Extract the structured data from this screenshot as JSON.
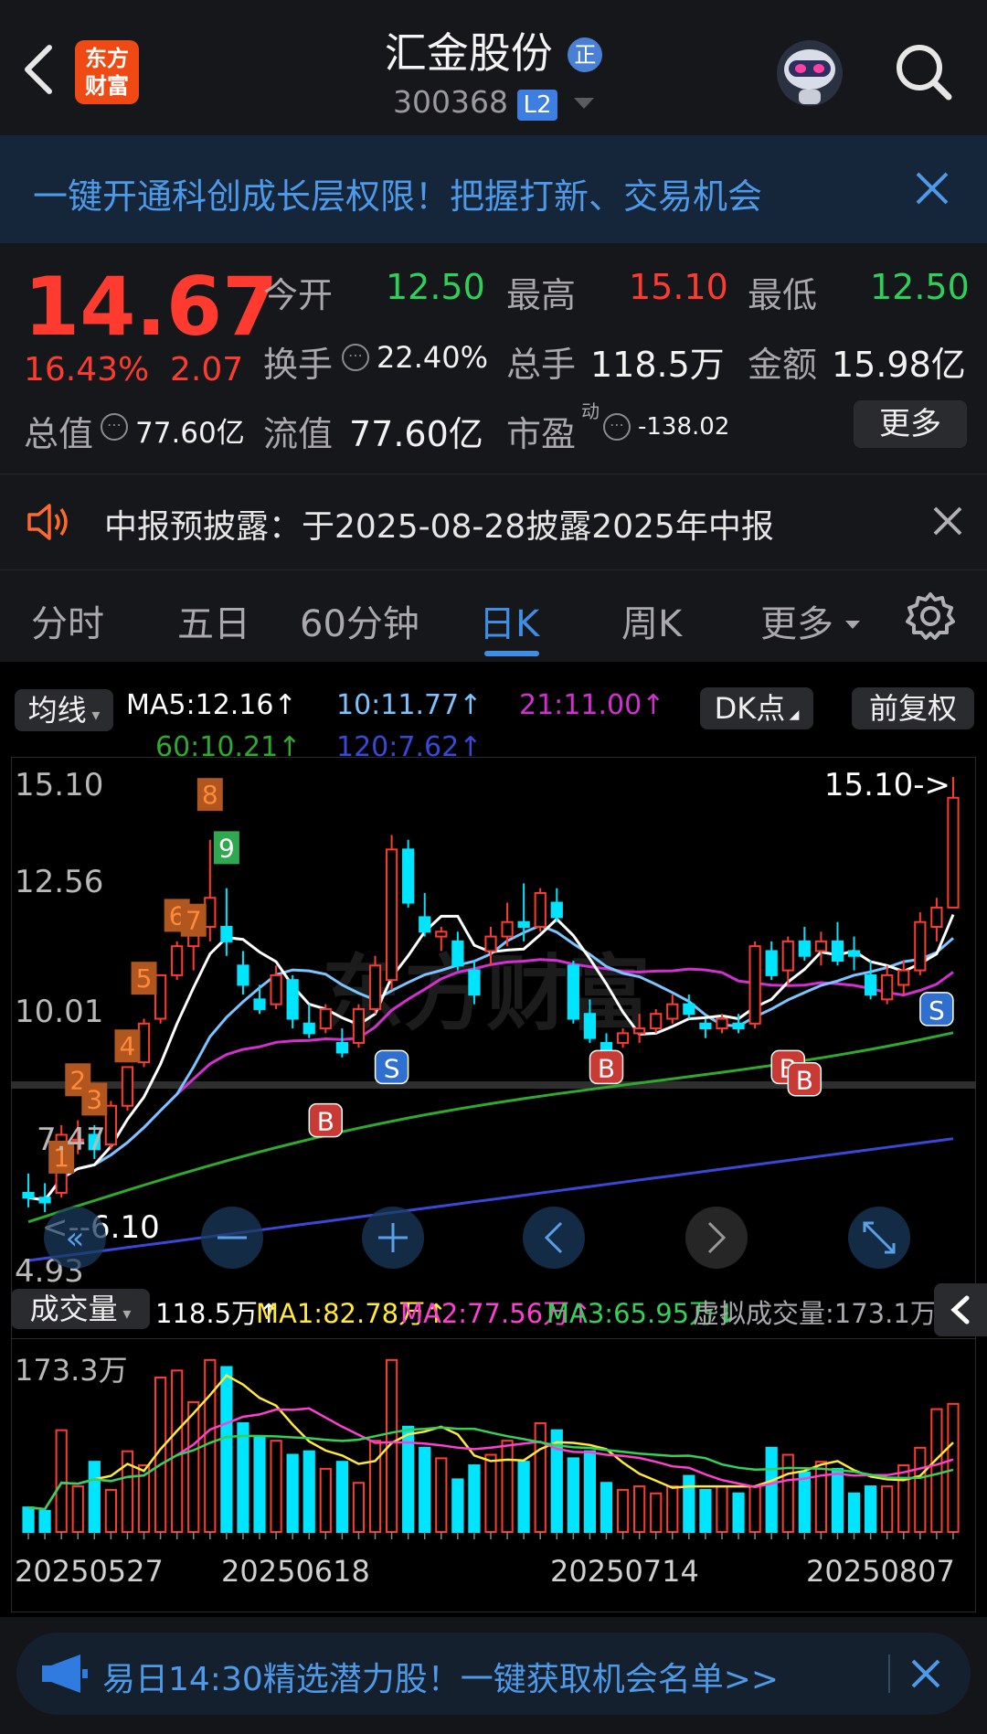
{
  "header": {
    "title": "汇金股份",
    "badge": "正",
    "logo_line1": "东方",
    "logo_line2": "财富",
    "code": "300368",
    "level": "L2"
  },
  "banner": {
    "text": "一键开通科创成长层权限！把握打新、交易机会"
  },
  "quote": {
    "price": "14.67",
    "change_pct": "16.43%",
    "change": "2.07",
    "open_label": "今开",
    "open": "12.50",
    "high_label": "最高",
    "high": "15.10",
    "low_label": "最低",
    "low": "12.50",
    "turnover_label": "换手",
    "turnover": "22.40%",
    "volume_label": "总手",
    "volume": "118.5万",
    "amount_label": "金额",
    "amount": "15.98亿",
    "mktcap_label": "总值",
    "mktcap": "77.60亿",
    "float_label": "流值",
    "float_cap": "77.60亿",
    "pe_label": "市盈",
    "pe_sup": "动",
    "pe": "-138.02",
    "more_label": "更多"
  },
  "notice": {
    "text": "中报预披露：于2025-08-28披露2025年中报"
  },
  "tabs": [
    "分时",
    "五日",
    "60分钟",
    "日K",
    "周K",
    "更多"
  ],
  "active_tab": 3,
  "chart_controls": {
    "ma_select": "均线",
    "ma5": "MA5:12.16↑",
    "ma10": "10:11.77↑",
    "ma21": "21:11.00↑",
    "ma60": "60:10.21↑",
    "ma120": "120:7.62↑",
    "dk_label": "DK点",
    "adjust_label": "前复权"
  },
  "price_axis": {
    "top": "15.10",
    "mid1": "12.56",
    "mid2": "10.01",
    "low1": "7.47",
    "bottom": "4.93"
  },
  "price_annot": {
    "high": "15.10->",
    "low": "<--6.10"
  },
  "volume": {
    "select": "成交量",
    "current": "118.5万↑",
    "ma1": "MA1:82.78万↑",
    "ma2": "MA2:77.56万↑",
    "ma3": "MA3:65.95万↓",
    "virtual": "虚拟成交量:173.1万",
    "axis_top": "173.3万"
  },
  "dates": [
    "20250527",
    "20250618",
    "20250714",
    "20250807"
  ],
  "signals": {
    "b": "B",
    "s": "S",
    "seq": [
      "1",
      "2",
      "3",
      "4",
      "5",
      "6",
      "7",
      "8",
      "9"
    ]
  },
  "watermark": "东方财富",
  "bottom_ad": {
    "text": "易日14:30精选潜力股！一键获取机会名单>>"
  },
  "colors": {
    "up": "#ff3b30",
    "down": "#00e5ff",
    "ma5": "#ffffff",
    "ma10": "#7cc4ff",
    "ma21": "#d42fd0",
    "ma60": "#2faa2f",
    "ma120": "#3a48d8",
    "accent": "#3d8fe6"
  },
  "chart_data": {
    "type": "candlestick",
    "x_labels": [
      "20250527",
      "20250618",
      "20250714",
      "20250807"
    ],
    "ylim": [
      4.93,
      15.1
    ],
    "candles": [
      {
        "o": 6.5,
        "h": 6.9,
        "l": 6.2,
        "c": 6.4
      },
      {
        "o": 6.4,
        "h": 6.7,
        "l": 6.1,
        "c": 6.3
      },
      {
        "o": 6.5,
        "h": 7.9,
        "l": 6.4,
        "c": 7.7
      },
      {
        "o": 7.6,
        "h": 8.0,
        "l": 7.3,
        "c": 7.6
      },
      {
        "o": 7.7,
        "h": 7.9,
        "l": 7.2,
        "c": 7.4
      },
      {
        "o": 7.5,
        "h": 8.4,
        "l": 7.4,
        "c": 8.3
      },
      {
        "o": 8.3,
        "h": 9.1,
        "l": 8.2,
        "c": 9.1
      },
      {
        "o": 9.2,
        "h": 10.1,
        "l": 9.1,
        "c": 10.0
      },
      {
        "o": 10.1,
        "h": 11.0,
        "l": 10.0,
        "c": 11.0
      },
      {
        "o": 11.0,
        "h": 11.7,
        "l": 10.9,
        "c": 11.6
      },
      {
        "o": 11.6,
        "h": 12.1,
        "l": 11.1,
        "c": 12.0
      },
      {
        "o": 12.0,
        "h": 13.8,
        "l": 11.7,
        "c": 12.6
      },
      {
        "o": 12.0,
        "h": 12.8,
        "l": 11.4,
        "c": 11.7
      },
      {
        "o": 11.2,
        "h": 11.5,
        "l": 10.6,
        "c": 10.8
      },
      {
        "o": 10.5,
        "h": 10.8,
        "l": 10.2,
        "c": 10.3
      },
      {
        "o": 10.4,
        "h": 11.2,
        "l": 10.3,
        "c": 11.0
      },
      {
        "o": 10.9,
        "h": 11.0,
        "l": 9.9,
        "c": 10.1
      },
      {
        "o": 10.0,
        "h": 10.4,
        "l": 9.7,
        "c": 9.8
      },
      {
        "o": 9.9,
        "h": 10.4,
        "l": 9.8,
        "c": 10.3
      },
      {
        "o": 9.6,
        "h": 9.9,
        "l": 9.3,
        "c": 9.4
      },
      {
        "o": 9.6,
        "h": 10.4,
        "l": 9.5,
        "c": 10.3
      },
      {
        "o": 10.3,
        "h": 11.4,
        "l": 10.2,
        "c": 11.2
      },
      {
        "o": 10.9,
        "h": 13.9,
        "l": 10.7,
        "c": 13.6
      },
      {
        "o": 13.6,
        "h": 13.8,
        "l": 12.4,
        "c": 12.5
      },
      {
        "o": 12.2,
        "h": 12.7,
        "l": 11.8,
        "c": 11.9
      },
      {
        "o": 11.8,
        "h": 12.0,
        "l": 11.5,
        "c": 11.9
      },
      {
        "o": 11.7,
        "h": 11.9,
        "l": 11.1,
        "c": 11.2
      },
      {
        "o": 11.1,
        "h": 11.3,
        "l": 10.4,
        "c": 10.6
      },
      {
        "o": 11.5,
        "h": 12.0,
        "l": 11.2,
        "c": 11.8
      },
      {
        "o": 11.8,
        "h": 12.5,
        "l": 11.6,
        "c": 12.1
      },
      {
        "o": 12.1,
        "h": 12.9,
        "l": 11.7,
        "c": 12.0
      },
      {
        "o": 12.0,
        "h": 12.8,
        "l": 11.9,
        "c": 12.7
      },
      {
        "o": 12.5,
        "h": 12.8,
        "l": 12.1,
        "c": 12.2
      },
      {
        "o": 11.2,
        "h": 11.3,
        "l": 10.0,
        "c": 10.1
      },
      {
        "o": 10.2,
        "h": 10.5,
        "l": 9.6,
        "c": 9.7
      },
      {
        "o": 9.6,
        "h": 9.8,
        "l": 9.3,
        "c": 9.4
      },
      {
        "o": 9.6,
        "h": 9.9,
        "l": 9.5,
        "c": 9.8
      },
      {
        "o": 9.8,
        "h": 10.2,
        "l": 9.6,
        "c": 9.9
      },
      {
        "o": 9.9,
        "h": 10.3,
        "l": 9.8,
        "c": 10.2
      },
      {
        "o": 10.1,
        "h": 10.6,
        "l": 10.0,
        "c": 10.4
      },
      {
        "o": 10.4,
        "h": 10.6,
        "l": 10.1,
        "c": 10.2
      },
      {
        "o": 10.0,
        "h": 10.1,
        "l": 9.7,
        "c": 9.9
      },
      {
        "o": 9.9,
        "h": 10.2,
        "l": 9.8,
        "c": 10.1
      },
      {
        "o": 10.0,
        "h": 10.2,
        "l": 9.8,
        "c": 9.9
      },
      {
        "o": 10.0,
        "h": 11.7,
        "l": 9.9,
        "c": 11.6
      },
      {
        "o": 11.5,
        "h": 11.7,
        "l": 10.9,
        "c": 11.0
      },
      {
        "o": 11.1,
        "h": 11.8,
        "l": 10.8,
        "c": 11.7
      },
      {
        "o": 11.7,
        "h": 12.0,
        "l": 11.3,
        "c": 11.4
      },
      {
        "o": 11.5,
        "h": 11.9,
        "l": 11.2,
        "c": 11.7
      },
      {
        "o": 11.7,
        "h": 12.1,
        "l": 11.2,
        "c": 11.3
      },
      {
        "o": 11.5,
        "h": 11.8,
        "l": 11.1,
        "c": 11.4
      },
      {
        "o": 11.0,
        "h": 11.3,
        "l": 10.5,
        "c": 10.6
      },
      {
        "o": 10.5,
        "h": 11.2,
        "l": 10.4,
        "c": 11.0
      },
      {
        "o": 10.8,
        "h": 11.3,
        "l": 10.6,
        "c": 11.1
      },
      {
        "o": 11.1,
        "h": 12.3,
        "l": 11.0,
        "c": 12.1
      },
      {
        "o": 12.0,
        "h": 12.6,
        "l": 11.7,
        "c": 12.4
      },
      {
        "o": 12.4,
        "h": 15.1,
        "l": 12.5,
        "c": 14.67
      }
    ]
  }
}
